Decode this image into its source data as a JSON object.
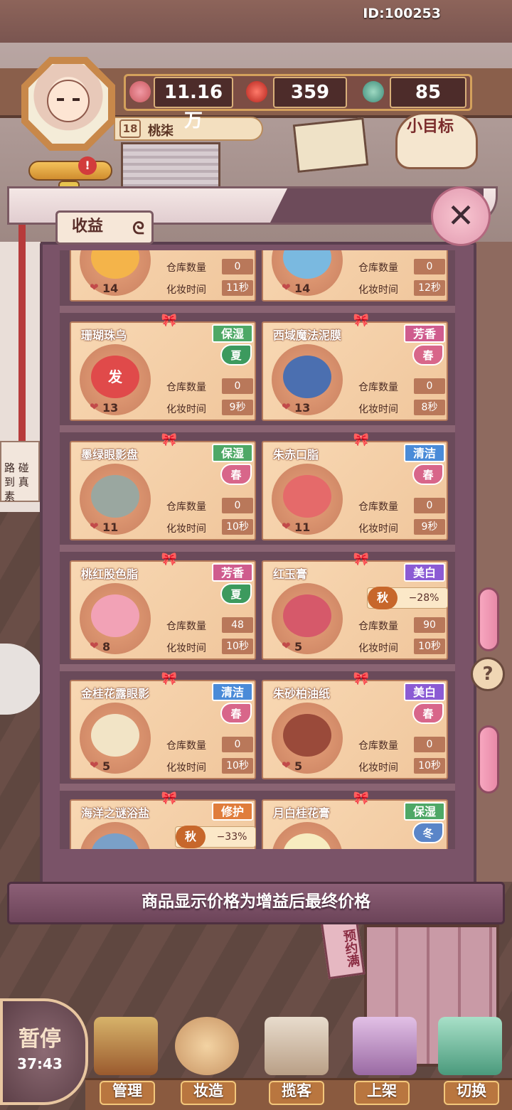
{
  "hud": {
    "player_id": "ID:100253",
    "level": "18",
    "player_name": "桃柒",
    "resources": [
      {
        "icon": "heart-coin-icon",
        "value": "11.16万"
      },
      {
        "icon": "red-gem-icon",
        "value": "359"
      },
      {
        "icon": "jade-ring-icon",
        "value": "85"
      }
    ],
    "alert_badge": "!",
    "goal_label": "小目标"
  },
  "panel": {
    "title": "收益",
    "title_icon": "swirl-icon",
    "close_icon": "close-icon",
    "footer_note": "商品显示价格为增益后最终价格"
  },
  "labels": {
    "stock": "仓库数量",
    "time": "化妆时间"
  },
  "items": [
    {
      "name": "",
      "tag": "",
      "season": "",
      "price": "14",
      "stock": "0",
      "time": "11秒"
    },
    {
      "name": "",
      "tag": "",
      "season": "",
      "price": "14",
      "stock": "0",
      "time": "12秒"
    },
    {
      "name": "珊瑚珠乌",
      "tag": "保湿",
      "tag_color": "green",
      "season": "夏",
      "season_color": "summer",
      "art": "发",
      "price": "13",
      "stock": "0",
      "time": "9秒"
    },
    {
      "name": "西域魔法泥膜",
      "tag": "芳香",
      "tag_color": "pink",
      "season": "春",
      "season_color": "spring",
      "price": "13",
      "stock": "0",
      "time": "8秒"
    },
    {
      "name": "墨绿眼影盘",
      "tag": "保湿",
      "tag_color": "green",
      "season": "春",
      "season_color": "spring",
      "price": "11",
      "stock": "0",
      "time": "10秒"
    },
    {
      "name": "朱赤口脂",
      "tag": "清洁",
      "tag_color": "blue",
      "season": "春",
      "season_color": "spring",
      "price": "11",
      "stock": "0",
      "time": "9秒"
    },
    {
      "name": "桃红股色脂",
      "tag": "芳香",
      "tag_color": "pink",
      "season": "夏",
      "season_color": "summer",
      "price": "8",
      "stock": "48",
      "time": "10秒"
    },
    {
      "name": "红玉膏",
      "tag": "美白",
      "tag_color": "purple",
      "season": "秋",
      "season_bonus": "−28%",
      "price": "5",
      "stock": "90",
      "time": "10秒"
    },
    {
      "name": "金桂花露眼影",
      "tag": "清洁",
      "tag_color": "blue",
      "season": "春",
      "season_color": "spring",
      "price": "5",
      "stock": "0",
      "time": "10秒"
    },
    {
      "name": "朱砂柏油纸",
      "tag": "美白",
      "tag_color": "purple",
      "season": "春",
      "season_color": "spring",
      "price": "5",
      "stock": "0",
      "time": "10秒"
    },
    {
      "name": "海洋之谜浴盐",
      "tag": "修护",
      "tag_color": "orange",
      "season": "秋",
      "season_bonus": "−33%",
      "price": "",
      "stock": "",
      "time": ""
    },
    {
      "name": "月白桂花膏",
      "tag": "保湿",
      "tag_color": "green",
      "season": "冬",
      "season_color": "winter",
      "price": "",
      "stock": "",
      "time": ""
    }
  ],
  "left_note": "路 碰到 真素",
  "scene_sign": "预约满",
  "help_icon": "question-icon",
  "pause": {
    "label": "暂停",
    "timer": "37:43"
  },
  "toolbar": [
    {
      "label": "管理",
      "icon": "shop-stall-icon"
    },
    {
      "label": "妆造",
      "icon": "makeup-plate-icon"
    },
    {
      "label": "揽客",
      "icon": "signpost-icon"
    },
    {
      "label": "上架",
      "icon": "shelf-book-icon"
    },
    {
      "label": "切换",
      "icon": "map-pin-icon"
    }
  ],
  "colors": {
    "tag_green": "#4ea866",
    "tag_pink": "#cf5c8e",
    "tag_blue": "#4a8bd8",
    "tag_purple": "#8b5bd4",
    "tag_orange": "#e07d3c",
    "card_bg": "#f4cea6",
    "cabinet": "#7a5368"
  }
}
